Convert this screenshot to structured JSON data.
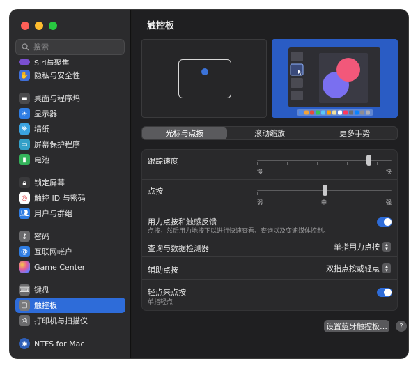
{
  "window_title": "触控板",
  "search": {
    "placeholder": "搜索"
  },
  "sidebar": {
    "partial_item": "Siri与聚焦",
    "items": [
      {
        "label": "隐私与安全性",
        "icon": "hand-icon",
        "color": "#3f6fd8"
      },
      {
        "label": "桌面与程序坞",
        "icon": "dock-icon",
        "color": "#4a4a4c"
      },
      {
        "label": "显示器",
        "icon": "sun-icon",
        "color": "#2f7de3"
      },
      {
        "label": "墙纸",
        "icon": "wallpaper-icon",
        "color": "#3aa3e0"
      },
      {
        "label": "屏幕保护程序",
        "icon": "screensaver-icon",
        "color": "#34a0c8"
      },
      {
        "label": "电池",
        "icon": "battery-icon",
        "color": "#34b35a"
      },
      {
        "label": "锁定屏幕",
        "icon": "lock-icon",
        "color": "#4a4a4c"
      },
      {
        "label": "触控 ID 与密码",
        "icon": "fingerprint-icon",
        "color": "#ffffff"
      },
      {
        "label": "用户与群组",
        "icon": "users-icon",
        "color": "#2f7de3"
      },
      {
        "label": "密码",
        "icon": "key-icon",
        "color": "#6a6a6c"
      },
      {
        "label": "互联网帐户",
        "icon": "at-icon",
        "color": "#2f7de3"
      },
      {
        "label": "Game Center",
        "icon": "game-center-icon",
        "color": "#c64fd6"
      },
      {
        "label": "键盘",
        "icon": "keyboard-icon",
        "color": "#6a6a6c"
      },
      {
        "label": "触控板",
        "icon": "trackpad-icon",
        "color": "#6a6a6c"
      },
      {
        "label": "打印机与扫描仪",
        "icon": "printer-icon",
        "color": "#6a6a6c"
      },
      {
        "label": "NTFS for Mac",
        "icon": "ntfs-icon",
        "color": "#2f5fb8"
      }
    ]
  },
  "tabs": [
    "光标与点按",
    "滚动缩放",
    "更多手势"
  ],
  "settings": {
    "tracking_speed": {
      "label": "跟踪速度",
      "min_label": "慢",
      "max_label": "快",
      "value": 0.83
    },
    "click": {
      "label": "点按",
      "min_label": "弱",
      "mid_label": "中",
      "max_label": "强",
      "value": 0.5
    },
    "force_click": {
      "label": "用力点按和触感反馈",
      "sub": "点按，然后用力地按下以进行快速查看、查询以及变速媒体控制。",
      "on": true
    },
    "lookup": {
      "label": "查询与数据检测器",
      "value": "单指用力点按"
    },
    "secondary_click": {
      "label": "辅助点按",
      "value": "双指点按或轻点"
    },
    "tap_to_click": {
      "label": "轻点来点按",
      "sub": "单指轻点",
      "on": true
    }
  },
  "footer": {
    "setup_button": "设置蓝牙触控板…",
    "help": "?"
  }
}
